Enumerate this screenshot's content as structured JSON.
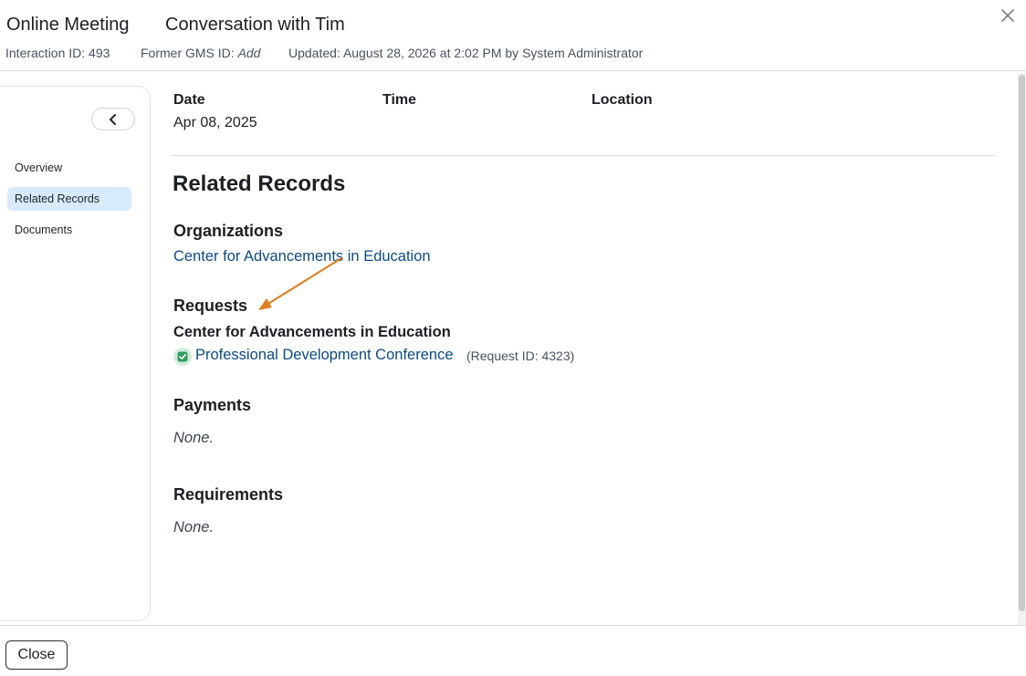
{
  "header": {
    "type": "Online Meeting",
    "title": "Conversation with Tim",
    "interaction_id": "Interaction ID: 493",
    "former_gms_label": "Former GMS ID:",
    "former_gms_value": "Add",
    "updated": "Updated: August 28, 2026 at 2:02 PM by System Administrator",
    "close_icon": "close-icon"
  },
  "sidebar": {
    "collapse_icon": "chevron-left-icon",
    "items": [
      {
        "label": "Overview",
        "active": false
      },
      {
        "label": "Related Records",
        "active": true
      },
      {
        "label": "Documents",
        "active": false
      }
    ]
  },
  "details": {
    "date_label": "Date",
    "date_value": "Apr 08, 2025",
    "time_label": "Time",
    "location_label": "Location"
  },
  "related": {
    "heading": "Related Records",
    "organizations": {
      "heading": "Organizations",
      "items": [
        "Center for Advancements in Education"
      ]
    },
    "requests": {
      "heading": "Requests",
      "organization": "Center for Advancements in Education",
      "status_icon": "check-status-icon",
      "request_name": "Professional Development Conference",
      "request_id": "(Request ID: 4323)"
    },
    "payments": {
      "heading": "Payments",
      "value": "None."
    },
    "requirements": {
      "heading": "Requirements",
      "value": "None."
    }
  },
  "annotation": {
    "arrow_color": "#e07e22"
  },
  "footer": {
    "close_label": "Close"
  },
  "colors": {
    "link": "#0d4a86",
    "active_nav": "#d8ebfb",
    "status_green": "#2e9e5b"
  }
}
